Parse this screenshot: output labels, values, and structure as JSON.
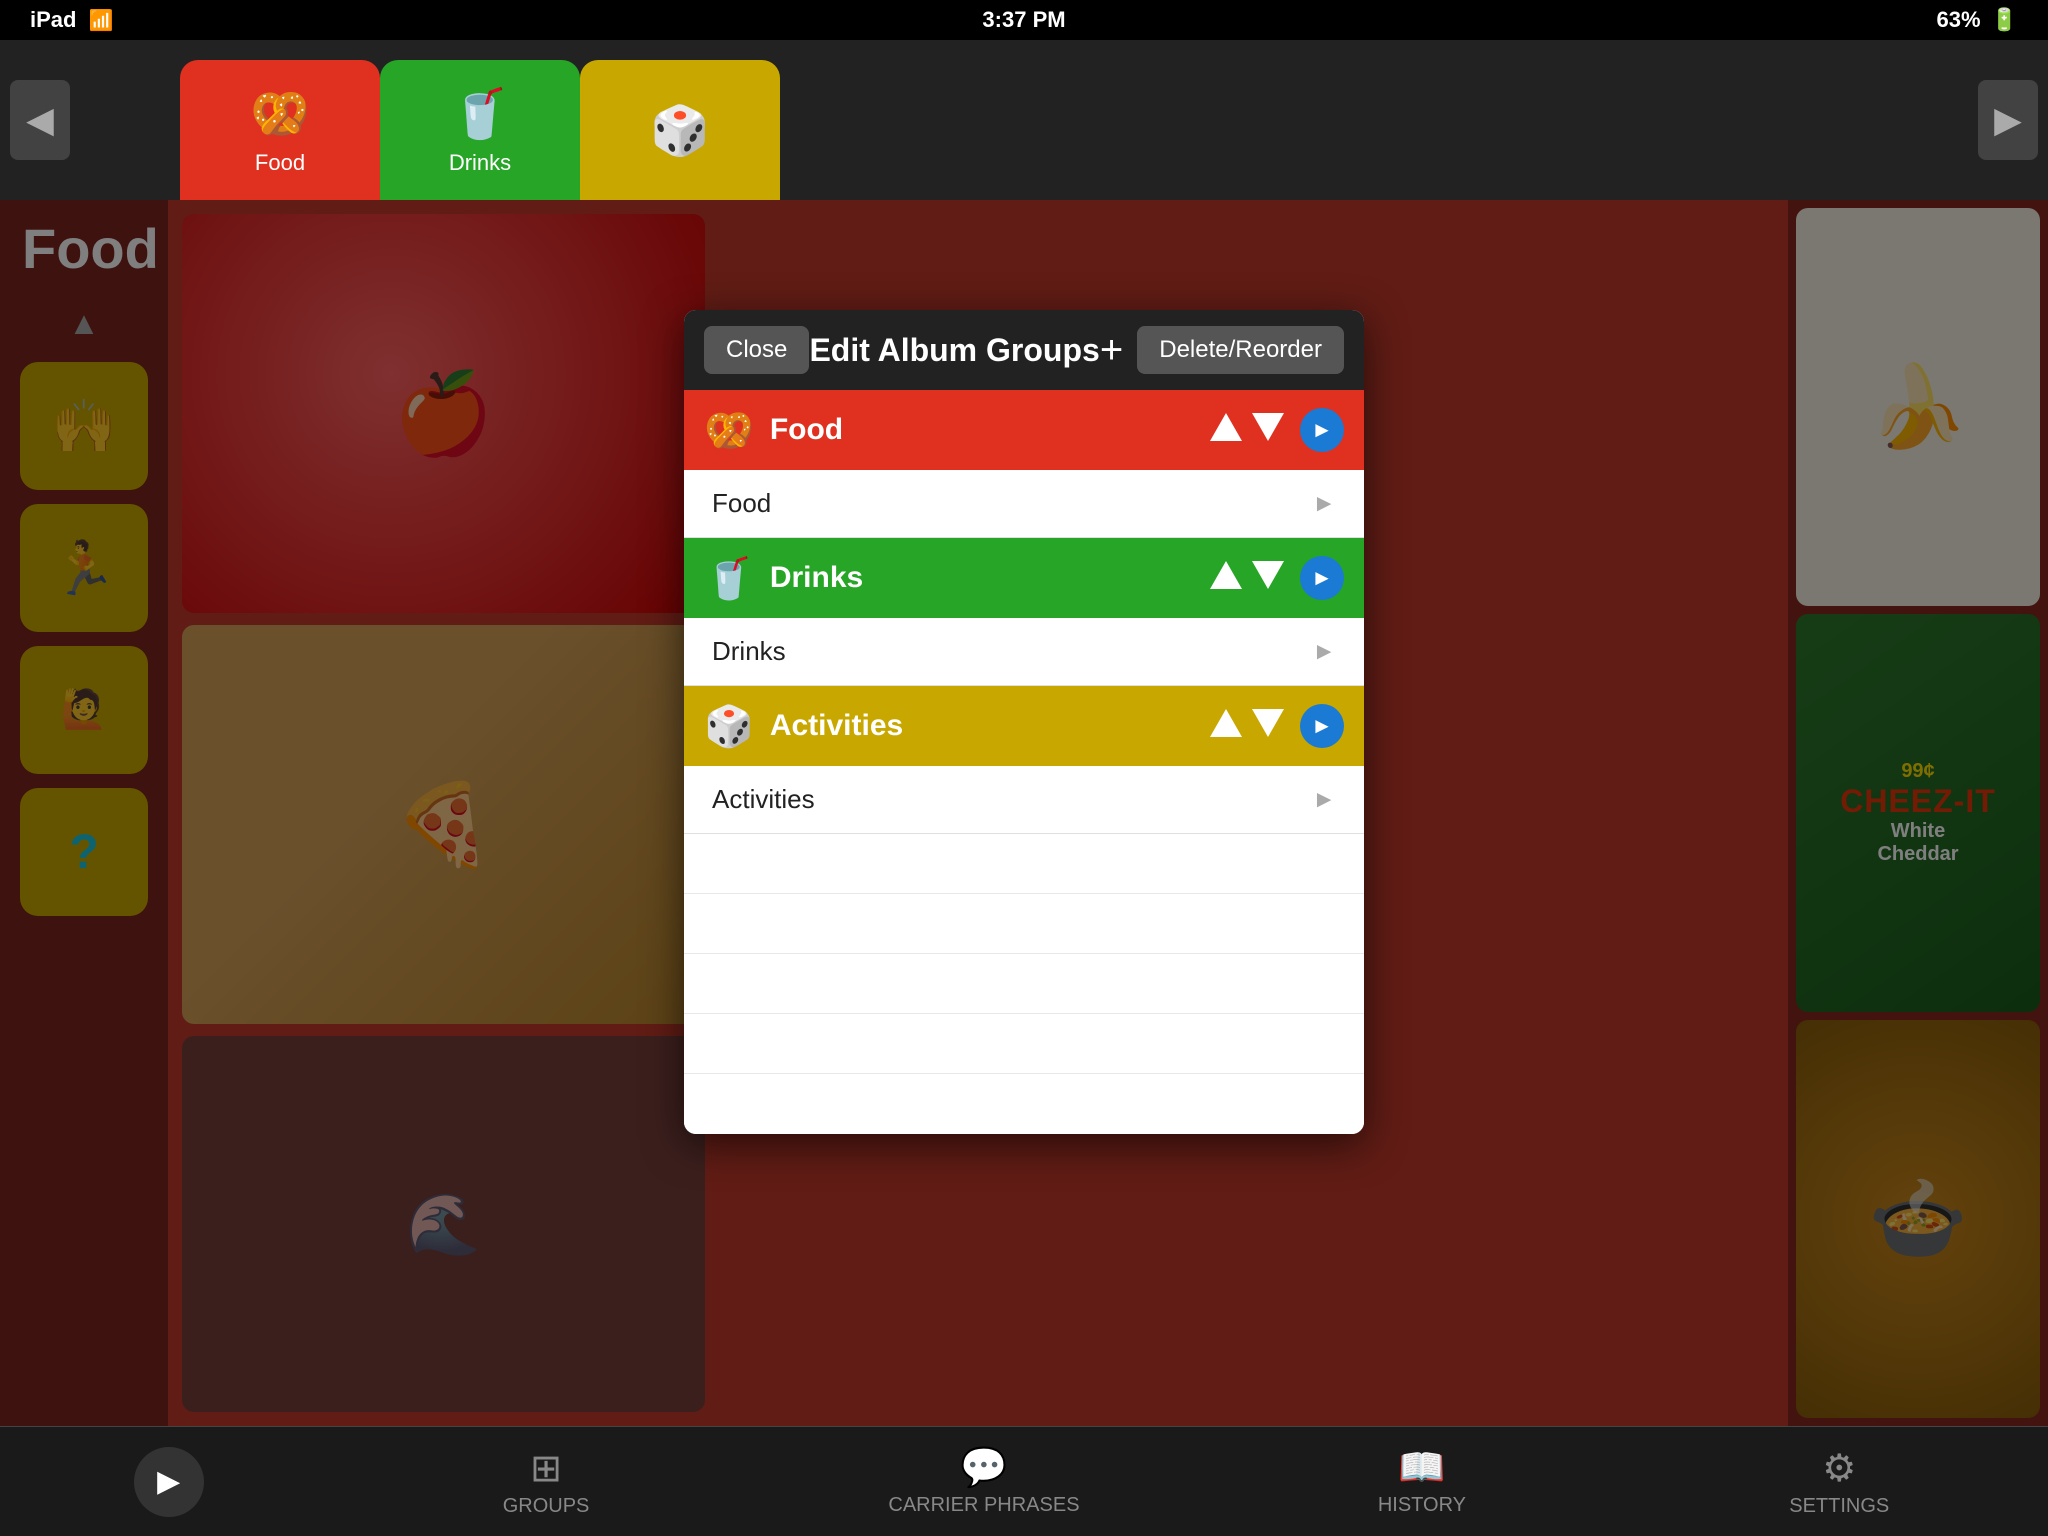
{
  "statusBar": {
    "device": "iPad",
    "time": "3:37 PM",
    "battery": "63%",
    "wifi": true
  },
  "tabs": [
    {
      "id": "food",
      "label": "Food",
      "icon": "🥨",
      "active": true,
      "color": "#e03020"
    },
    {
      "id": "drinks",
      "label": "Drinks",
      "icon": "🥤",
      "active": false,
      "color": "#27a527"
    },
    {
      "id": "activities",
      "label": "",
      "icon": "🎲",
      "active": false,
      "color": "#c8a800"
    }
  ],
  "sidebarTitle": "Food",
  "modal": {
    "title": "Edit Album Groups",
    "closeLabel": "Close",
    "addLabel": "+",
    "deleteReorderLabel": "Delete/Reorder",
    "groups": [
      {
        "id": "food",
        "name": "Food",
        "icon": "🥨",
        "color": "food-row",
        "subItem": "Food"
      },
      {
        "id": "drinks",
        "name": "Drinks",
        "icon": "🥤",
        "color": "drinks-row",
        "subItem": "Drinks"
      },
      {
        "id": "activities",
        "name": "Activities",
        "icon": "🎲",
        "color": "activities-row",
        "subItem": "Activities"
      }
    ]
  },
  "bottomTabs": [
    {
      "id": "play",
      "icon": "▶",
      "label": "",
      "isPlay": true
    },
    {
      "id": "groups",
      "icon": "⊞",
      "label": "GROUPS",
      "active": false
    },
    {
      "id": "carrier-phrases",
      "icon": "💬",
      "label": "CARRIER PHRASES",
      "active": false
    },
    {
      "id": "history",
      "icon": "📖",
      "label": "HISTORY",
      "active": false
    },
    {
      "id": "settings",
      "icon": "⚙",
      "label": "SETTINGS",
      "active": false
    }
  ],
  "sidebarButtons": [
    {
      "id": "btn1",
      "icon": "🙌"
    },
    {
      "id": "btn2",
      "icon": "🏃"
    },
    {
      "id": "btn3",
      "icon": "🙋"
    },
    {
      "id": "btn4",
      "icon": "❓"
    }
  ]
}
